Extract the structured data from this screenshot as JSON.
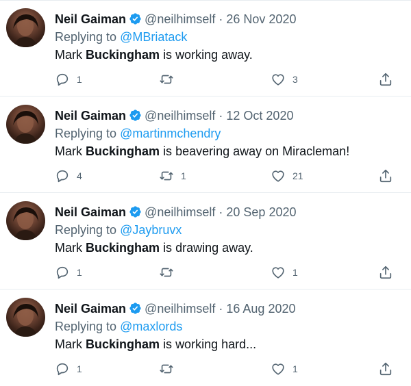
{
  "tweets": [
    {
      "author": "Neil Gaiman",
      "handle": "@neilhimself",
      "date": "26 Nov 2020",
      "replying_prefix": "Replying to",
      "replying_to": "@MBriatack",
      "text_before": "Mark",
      "text_bold": "Buckingham",
      "text_after": "is working away.",
      "reply_count": "1",
      "retweet_count": "",
      "like_count": "3"
    },
    {
      "author": "Neil Gaiman",
      "handle": "@neilhimself",
      "date": "12 Oct 2020",
      "replying_prefix": "Replying to",
      "replying_to": "@martinmchendry",
      "text_before": "Mark",
      "text_bold": "Buckingham",
      "text_after": "is beavering away on Miracleman!",
      "reply_count": "4",
      "retweet_count": "1",
      "like_count": "21"
    },
    {
      "author": "Neil Gaiman",
      "handle": "@neilhimself",
      "date": "20 Sep 2020",
      "replying_prefix": "Replying to",
      "replying_to": "@Jaybruvx",
      "text_before": "Mark",
      "text_bold": "Buckingham",
      "text_after": "is drawing away.",
      "reply_count": "1",
      "retweet_count": "",
      "like_count": "1"
    },
    {
      "author": "Neil Gaiman",
      "handle": "@neilhimself",
      "date": "16 Aug 2020",
      "replying_prefix": "Replying to",
      "replying_to": "@maxlords",
      "text_before": "Mark",
      "text_bold": "Buckingham",
      "text_after": "is working hard...",
      "reply_count": "1",
      "retweet_count": "",
      "like_count": "1"
    }
  ],
  "separator": "·",
  "icons": {
    "verified": "verified-badge-icon",
    "reply": "reply-icon",
    "retweet": "retweet-icon",
    "like": "heart-icon",
    "share": "share-icon"
  },
  "colors": {
    "link": "#1d9bf0",
    "verified": "#1d9bf0",
    "muted": "#536471",
    "text": "#0f1419"
  }
}
